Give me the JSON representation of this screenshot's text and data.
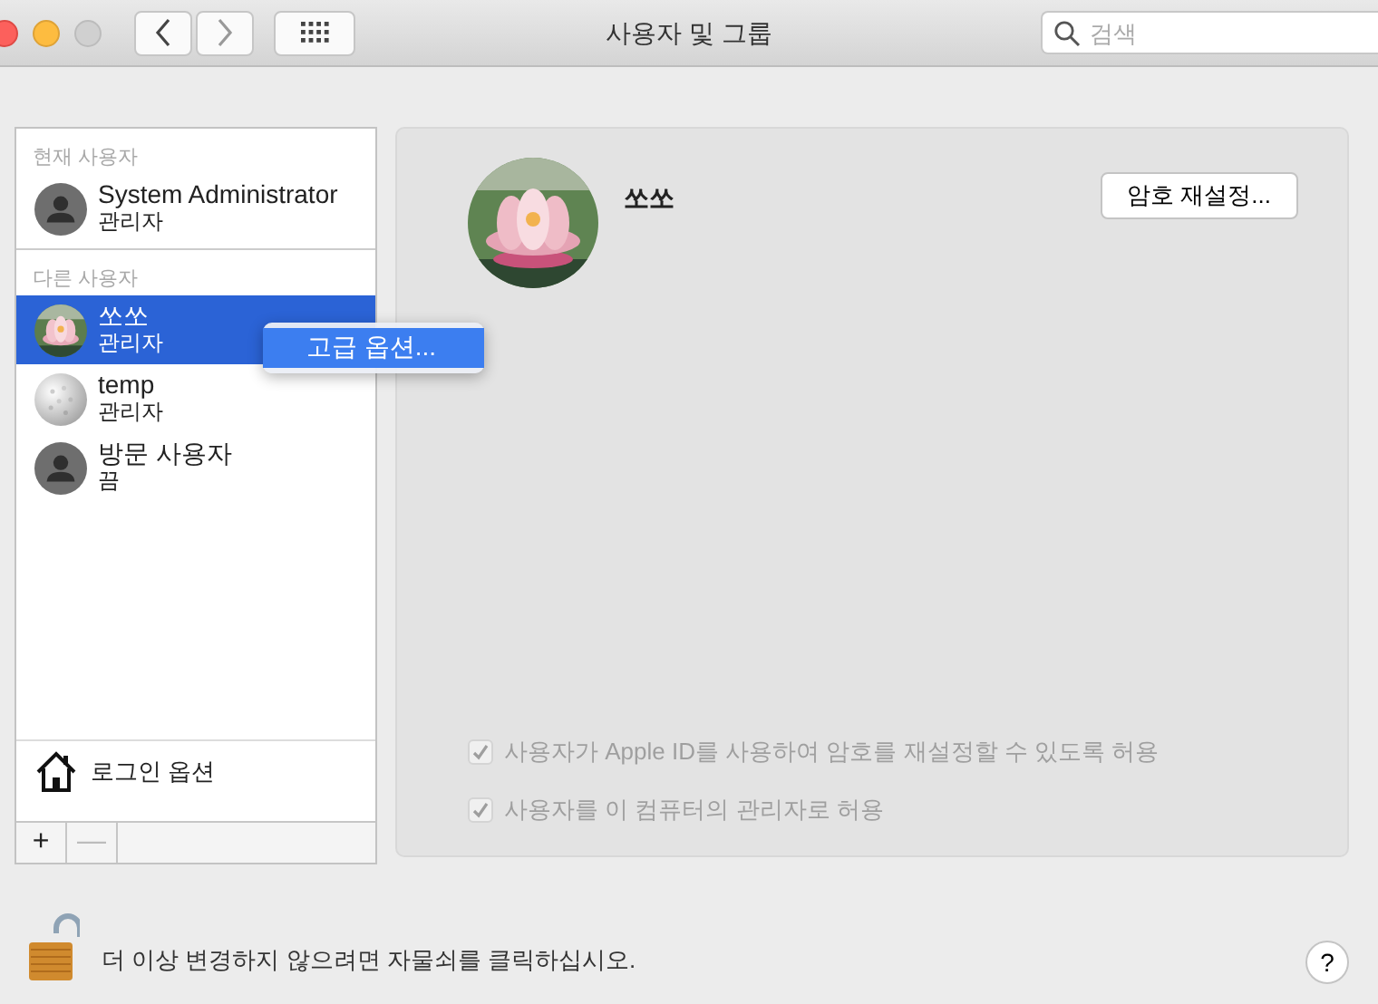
{
  "window": {
    "title": "사용자 및 그룹",
    "search": {
      "placeholder": "검색"
    }
  },
  "sidebar": {
    "sections": [
      {
        "heading": "현재 사용자",
        "users": [
          {
            "name": "System Administrator",
            "role": "관리자",
            "kind": "person",
            "selected": false
          }
        ]
      },
      {
        "heading": "다른 사용자",
        "users": [
          {
            "name": "쏘쏘",
            "role": "관리자",
            "kind": "lotus",
            "selected": true
          },
          {
            "name": "temp",
            "role": "관리자",
            "kind": "ball",
            "selected": false
          },
          {
            "name": "방문 사용자",
            "role": "끔",
            "kind": "person",
            "selected": false
          }
        ]
      }
    ],
    "login_options": "로그인 옵션",
    "buttons": [
      {
        "label": "+",
        "disabled": false
      },
      {
        "label": "—",
        "disabled": true
      }
    ]
  },
  "context_menu": {
    "items": [
      {
        "label": "고급 옵션...",
        "selected": true
      }
    ]
  },
  "detail": {
    "name": "쏘쏘",
    "reset_button": "암호 재설정...",
    "options": [
      {
        "label": "사용자가 Apple ID를 사용하여 암호를 재설정할 수 있도록 허용",
        "checked": true,
        "disabled": true
      },
      {
        "label": "사용자를 이 컴퓨터의 관리자로 허용",
        "checked": true,
        "disabled": true
      }
    ]
  },
  "lock": {
    "locked": false,
    "message": "더 이상 변경하지 않으려면 자물쇠를 클릭하십시오."
  },
  "help": "?"
}
